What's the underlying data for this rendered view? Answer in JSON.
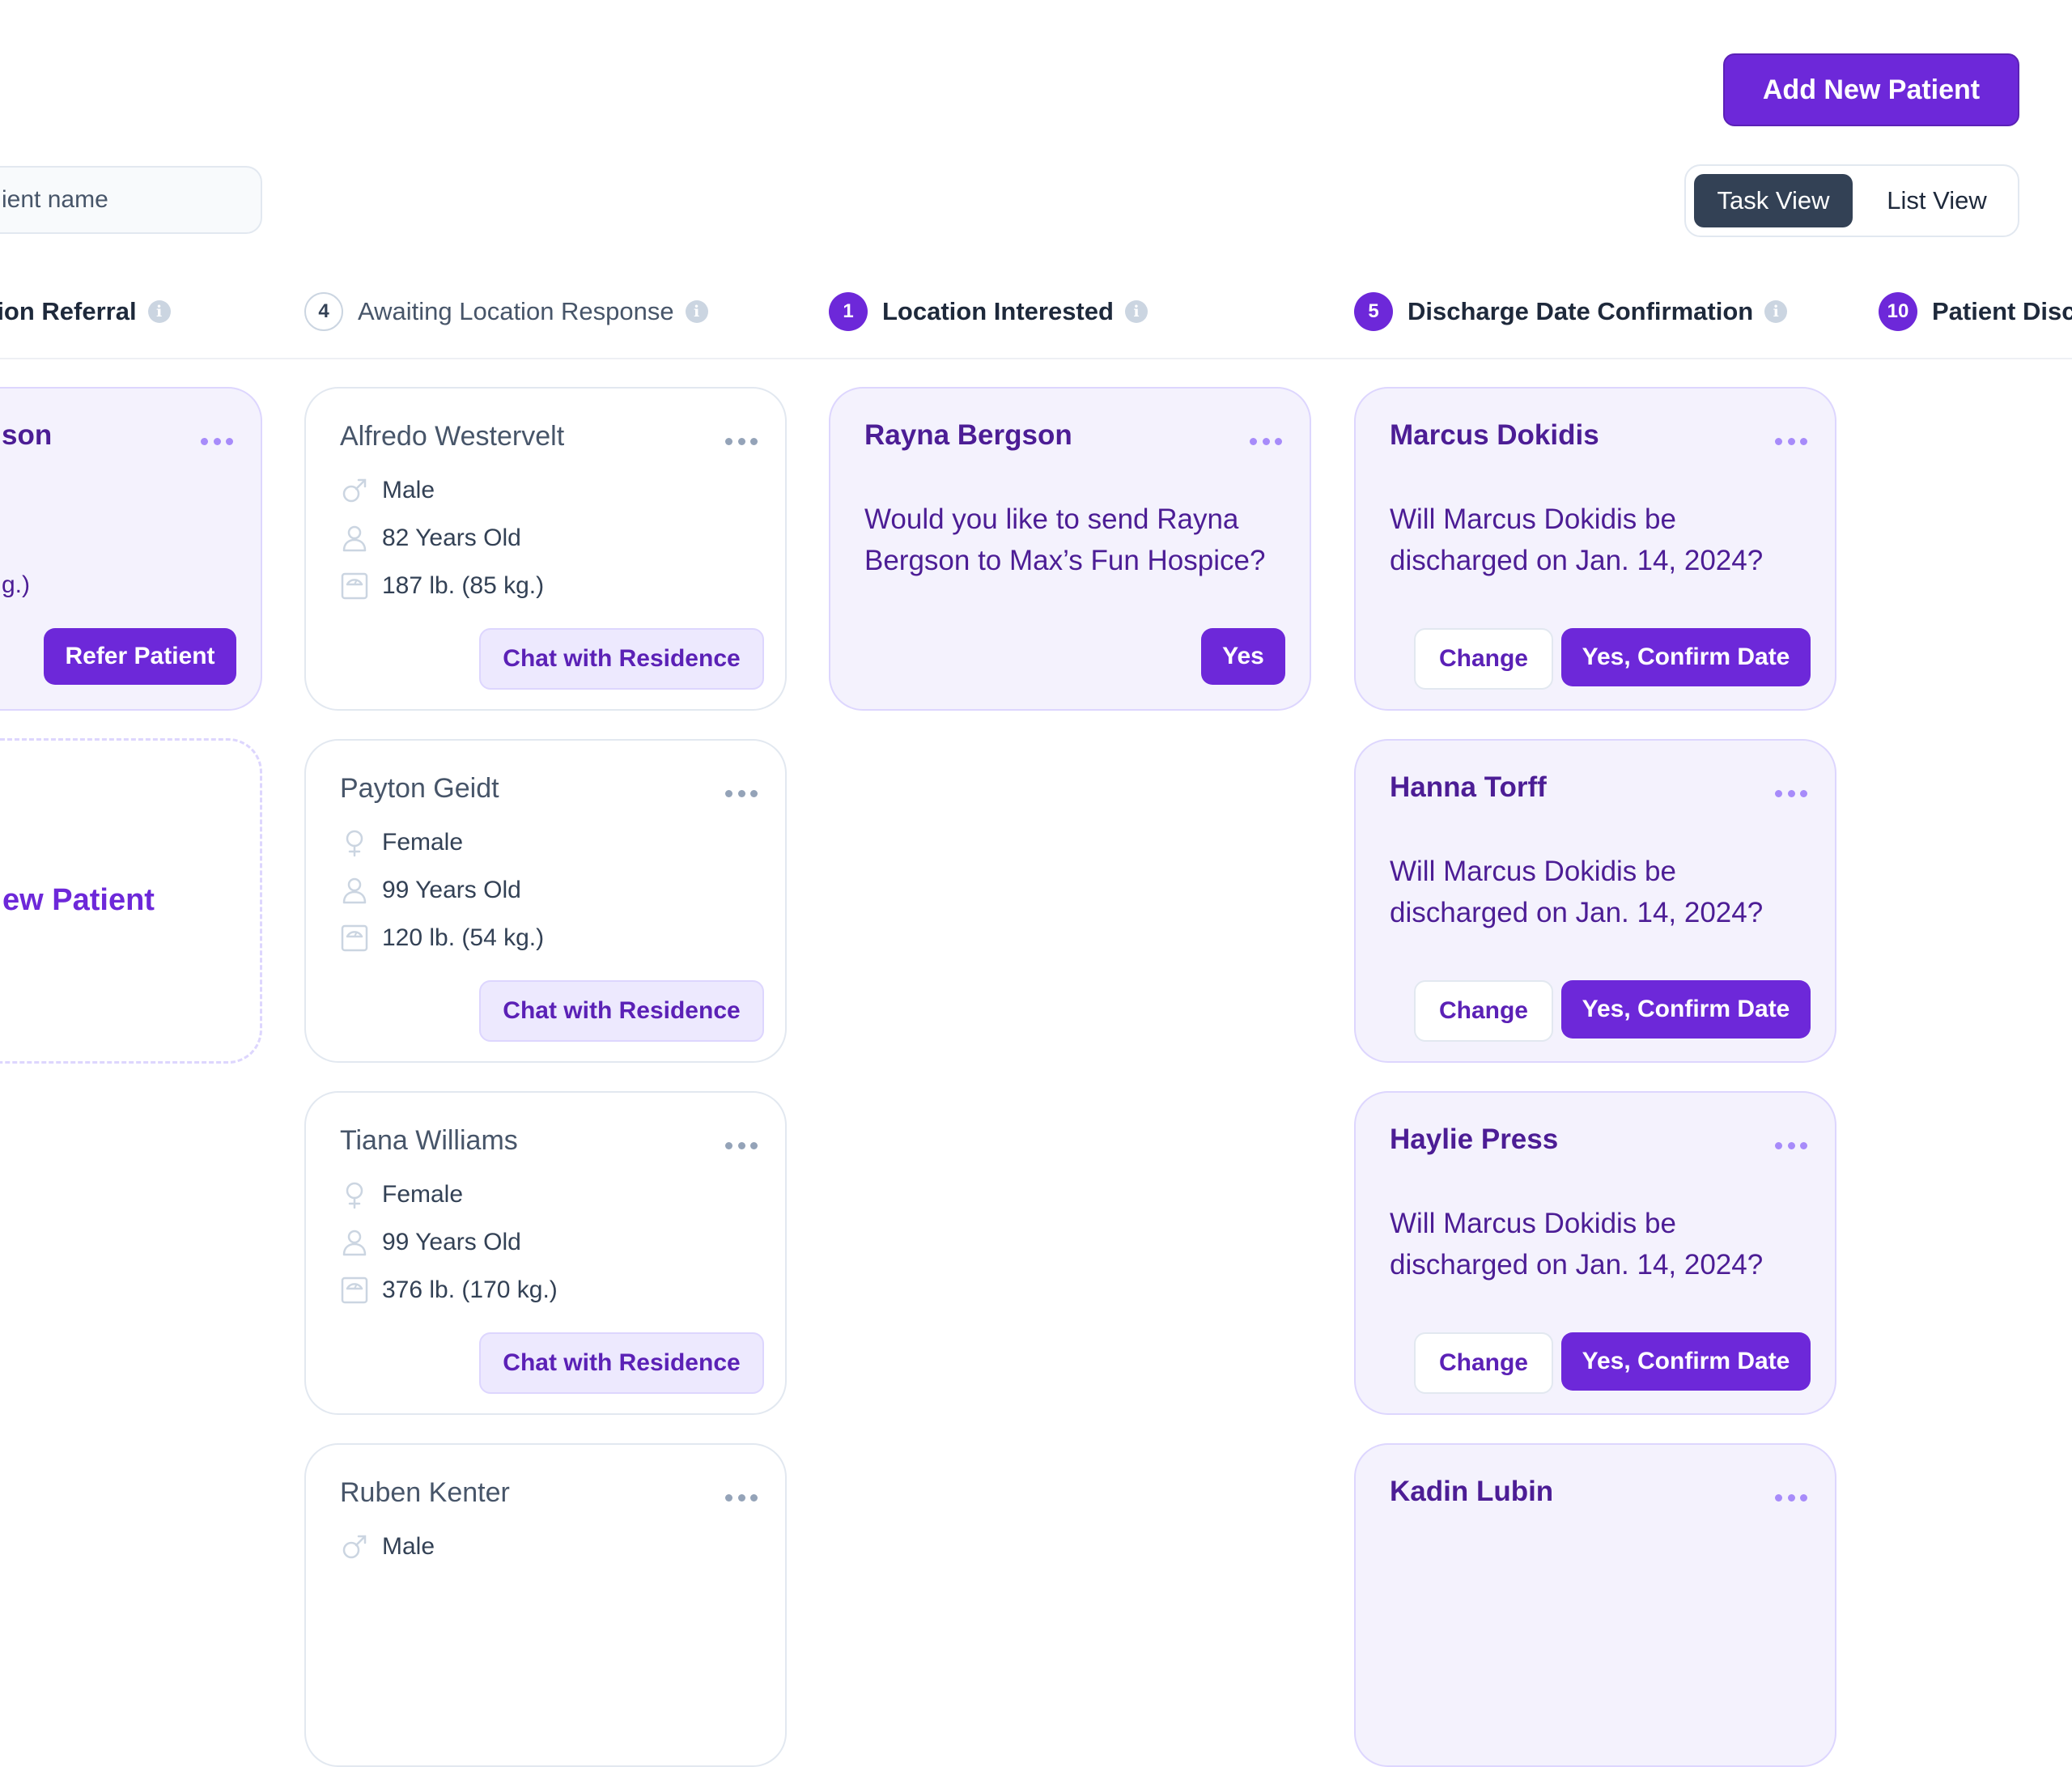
{
  "header": {
    "add_patient_label": "Add New Patient",
    "search_placeholder": "ient name",
    "views": {
      "task": "Task View",
      "list": "List View",
      "active": "task"
    }
  },
  "colors": {
    "accent": "#6d28d9",
    "accent_dark": "#4c1d95",
    "card_lavender": "#f4f2fd",
    "view_toggle_active": "#334155"
  },
  "columns": [
    {
      "count": "",
      "title": "tion Referral"
    },
    {
      "count": "4",
      "title": "Awaiting Location Response"
    },
    {
      "count": "1",
      "title": "Location Interested"
    },
    {
      "count": "5",
      "title": "Discharge Date Confirmation"
    },
    {
      "count": "10",
      "title": "Patient Disc"
    }
  ],
  "referral_column": {
    "card": {
      "name": "son",
      "weight_tail": "g.)",
      "button": "Refer Patient"
    },
    "add_patient_link": "ew Patient"
  },
  "awaiting_column": {
    "button": "Chat with Residence",
    "cards": [
      {
        "name": "Alfredo Westervelt",
        "gender": "Male",
        "gender_icon": "male-icon",
        "age": "82 Years Old",
        "weight": "187 lb. (85 kg.)"
      },
      {
        "name": "Payton Geidt",
        "gender": "Female",
        "gender_icon": "female-icon",
        "age": "99 Years Old",
        "weight": "120 lb. (54 kg.)"
      },
      {
        "name": "Tiana Williams",
        "gender": "Female",
        "gender_icon": "female-icon",
        "age": "99 Years Old",
        "weight": "376 lb. (170 kg.)"
      },
      {
        "name": "Ruben Kenter",
        "gender": "Male",
        "gender_icon": "male-icon"
      }
    ]
  },
  "interested_column": {
    "cards": [
      {
        "name": "Rayna Bergson",
        "question": "Would you like to send Rayna Bergson to Max’s Fun Hospice?",
        "button": "Yes"
      }
    ]
  },
  "discharge_column": {
    "change_label": "Change",
    "confirm_label": "Yes, Confirm Date",
    "cards": [
      {
        "name": "Marcus Dokidis",
        "question": "Will Marcus Dokidis be discharged on Jan. 14, 2024?"
      },
      {
        "name": "Hanna Torff",
        "question": "Will Marcus Dokidis be discharged on Jan. 14, 2024?"
      },
      {
        "name": "Haylie Press",
        "question": "Will Marcus Dokidis be discharged on Jan. 14, 2024?"
      },
      {
        "name": "Kadin Lubin"
      }
    ]
  }
}
